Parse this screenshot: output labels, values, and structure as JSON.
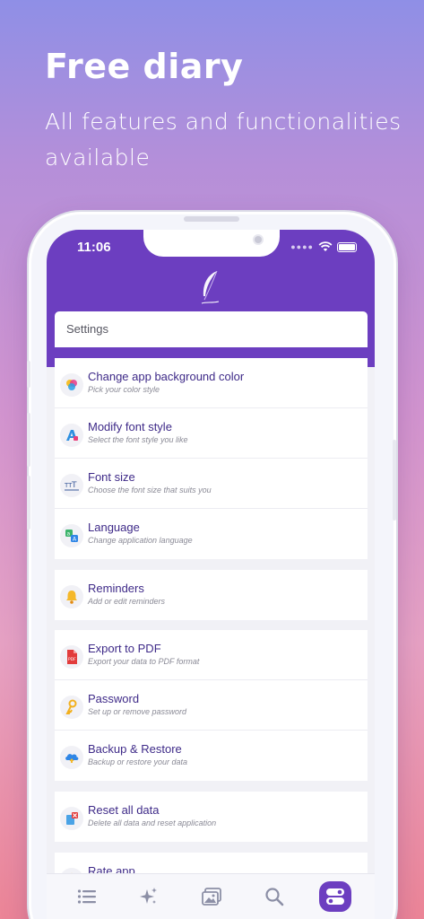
{
  "promo": {
    "title": "Free diary",
    "subtitle": "All features and functionalities available"
  },
  "status_bar": {
    "time": "11:06"
  },
  "header": {
    "logo_icon": "feather-quill-icon"
  },
  "settings": {
    "title": "Settings"
  },
  "groups": [
    {
      "items": [
        {
          "icon": "color-palette-icon",
          "label": "Change app background color",
          "subtitle": "Pick your color style"
        },
        {
          "icon": "font-style-icon",
          "label": "Modify font style",
          "subtitle": "Select the font style you like"
        },
        {
          "icon": "font-size-icon",
          "label": "Font size",
          "subtitle": "Choose the font size that suits you"
        },
        {
          "icon": "language-icon",
          "label": "Language",
          "subtitle": "Change application language"
        }
      ]
    },
    {
      "items": [
        {
          "icon": "bell-icon",
          "label": "Reminders",
          "subtitle": "Add or edit reminders"
        }
      ]
    },
    {
      "items": [
        {
          "icon": "pdf-file-icon",
          "label": "Export to PDF",
          "subtitle": "Export your data to PDF format"
        },
        {
          "icon": "key-icon",
          "label": "Password",
          "subtitle": "Set up or remove password"
        },
        {
          "icon": "cloud-backup-icon",
          "label": "Backup & Restore",
          "subtitle": "Backup or restore your data"
        }
      ]
    },
    {
      "items": [
        {
          "icon": "reset-data-icon",
          "label": "Reset all data",
          "subtitle": "Delete all data and reset application"
        }
      ]
    },
    {
      "items": [
        {
          "icon": "star-icon",
          "label": "Rate app",
          "subtitle": ""
        }
      ]
    }
  ],
  "bottom_nav": [
    {
      "icon": "list-icon",
      "active": false
    },
    {
      "icon": "sparkles-icon",
      "active": false
    },
    {
      "icon": "gallery-icon",
      "active": false
    },
    {
      "icon": "search-icon",
      "active": false
    },
    {
      "icon": "settings-toggle-icon",
      "active": true
    }
  ],
  "colors": {
    "header_purple": "#6c3ec0",
    "label_text": "#3e2a88",
    "active_nav": "#6c3ec0"
  }
}
